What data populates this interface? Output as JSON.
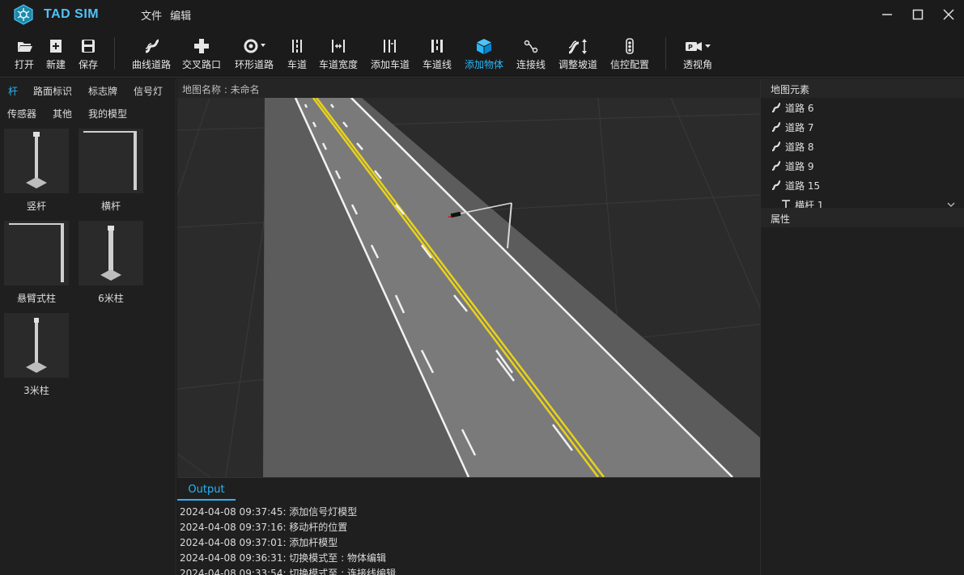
{
  "app": {
    "title": "TAD SIM"
  },
  "menu": [
    "文件",
    "编辑"
  ],
  "toolbar": {
    "items": [
      {
        "label": "打开",
        "icon": "folder-open-icon"
      },
      {
        "label": "新建",
        "icon": "new-file-icon"
      },
      {
        "label": "保存",
        "icon": "save-icon"
      },
      {
        "label": "曲线道路",
        "icon": "curve-road-icon"
      },
      {
        "label": "交叉路口",
        "icon": "junction-icon"
      },
      {
        "label": "环形道路",
        "icon": "roundabout-icon"
      },
      {
        "label": "车道",
        "icon": "lane-icon"
      },
      {
        "label": "车道宽度",
        "icon": "lane-width-icon"
      },
      {
        "label": "添加车道",
        "icon": "add-lane-icon"
      },
      {
        "label": "车道线",
        "icon": "lane-line-icon"
      },
      {
        "label": "添加物体",
        "icon": "add-object-icon",
        "active": true
      },
      {
        "label": "连接线",
        "icon": "link-line-icon"
      },
      {
        "label": "调整坡道",
        "icon": "slope-icon"
      },
      {
        "label": "信控配置",
        "icon": "traffic-light-config-icon"
      },
      {
        "label": "透视角",
        "icon": "camera-icon"
      }
    ],
    "accent_color": "#29b6f6"
  },
  "left_panel": {
    "tabs_row1": [
      "杆",
      "路面标识",
      "标志牌",
      "信号灯"
    ],
    "tabs_row2": [
      "传感器",
      "其他",
      "我的模型"
    ],
    "active_tab": "杆",
    "models": [
      {
        "label": "竖杆",
        "icon": "vertical-pole-icon"
      },
      {
        "label": "横杆",
        "icon": "horizontal-pole-icon"
      },
      {
        "label": "悬臂式柱",
        "icon": "cantilever-pole-icon"
      },
      {
        "label": "6米柱",
        "icon": "pillar-6m-icon"
      },
      {
        "label": "3米柱",
        "icon": "pillar-3m-icon"
      }
    ]
  },
  "viewport": {
    "map_name_label": "地图名称 : 未命名"
  },
  "output": {
    "tab": "Output",
    "lines": [
      "2024-04-08 09:37:45: 添加信号灯模型",
      "2024-04-08 09:37:16: 移动杆的位置",
      "2024-04-08 09:37:01: 添加杆模型",
      "2024-04-08 09:36:31: 切换模式至 : 物体编辑",
      "2024-04-08 09:33:54: 切换模式至 : 连接线编辑"
    ]
  },
  "right_panel": {
    "elements_title": "地图元素",
    "elements": [
      "道路 6",
      "道路 7",
      "道路 8",
      "道路 9",
      "道路 15",
      "横杆 1"
    ],
    "properties_title": "属性"
  }
}
